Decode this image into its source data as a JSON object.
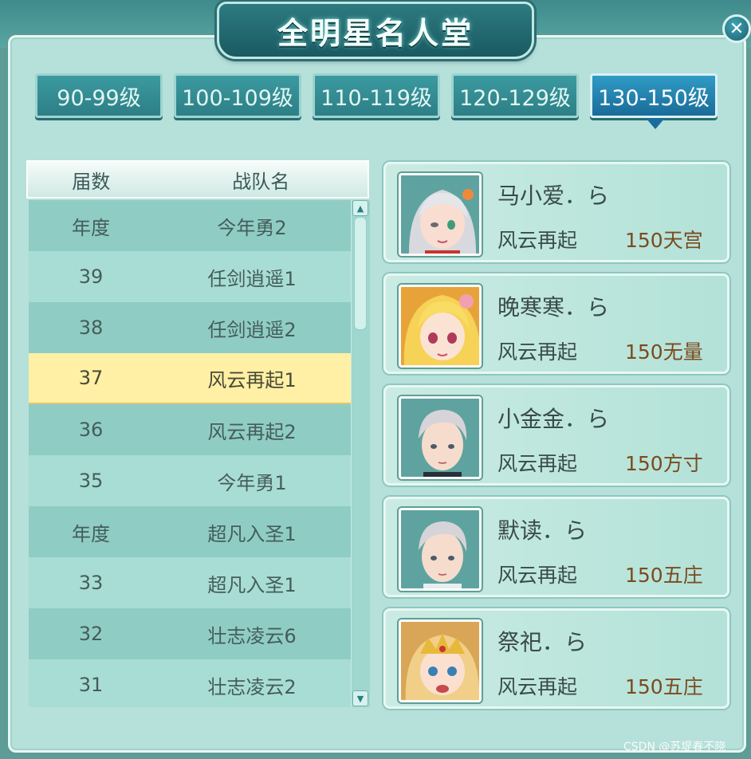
{
  "window": {
    "title": "全明星名人堂",
    "close_icon": "close-icon"
  },
  "tabs": [
    {
      "label": "90-99级",
      "active": false
    },
    {
      "label": "100-109级",
      "active": false
    },
    {
      "label": "110-119级",
      "active": false
    },
    {
      "label": "120-129级",
      "active": false
    },
    {
      "label": "130-150级",
      "active": true
    }
  ],
  "list": {
    "headers": {
      "session": "届数",
      "team": "战队名"
    },
    "rows": [
      {
        "session": "年度",
        "team": "今年勇2"
      },
      {
        "session": "39",
        "team": "任剑逍遥1"
      },
      {
        "session": "38",
        "team": "任剑逍遥2"
      },
      {
        "session": "37",
        "team": "风云再起1"
      },
      {
        "session": "36",
        "team": "风云再起2"
      },
      {
        "session": "35",
        "team": "今年勇1"
      },
      {
        "session": "年度",
        "team": "超凡入圣1"
      },
      {
        "session": "33",
        "team": "超凡入圣1"
      },
      {
        "session": "32",
        "team": "壮志凌云6"
      },
      {
        "session": "31",
        "team": "壮志凌云2"
      }
    ],
    "selected_index": 3
  },
  "members": [
    {
      "name": "马小爱．ら",
      "team": "风云再起",
      "level": "150天宫",
      "avatar_icon": "avatar-silver-hair-girl-icon"
    },
    {
      "name": "晚寒寒．ら",
      "team": "风云再起",
      "level": "150无量",
      "avatar_icon": "avatar-blonde-girl-icon"
    },
    {
      "name": "小金金．ら",
      "team": "风云再起",
      "level": "150方寸",
      "avatar_icon": "avatar-silver-hair-boy-icon"
    },
    {
      "name": "默读．ら",
      "team": "风云再起",
      "level": "150五庄",
      "avatar_icon": "avatar-silver-hair-boy-icon"
    },
    {
      "name": "祭祀．ら",
      "team": "风云再起",
      "level": "150五庄",
      "avatar_icon": "avatar-golden-crown-girl-icon"
    }
  ],
  "watermark": "CSDN @苏堤春不晓",
  "colors": {
    "panel": "#b6e0da",
    "tab": "#2d7f86",
    "tab_active": "#1a6c99",
    "selected_row": "#fff0a5",
    "level_text": "#7c4a1f"
  }
}
